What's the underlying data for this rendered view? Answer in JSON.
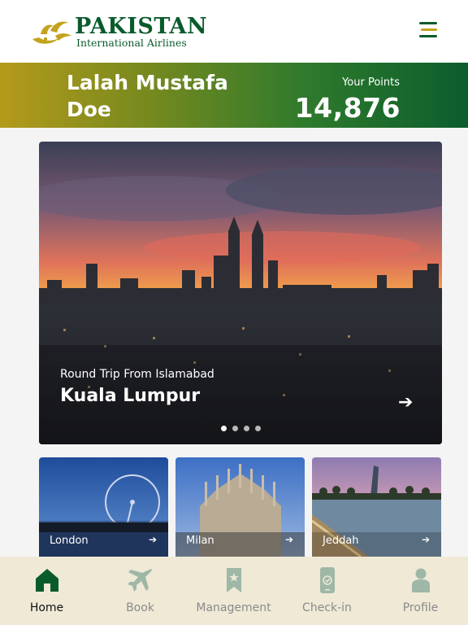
{
  "header": {
    "logo_title": "PAKISTAN",
    "logo_subtitle": "International Airlines",
    "menu_icon": "hamburger-icon"
  },
  "user": {
    "name": "Lalah Mustafa Doe",
    "points_label": "Your Points",
    "points_value": "14,876"
  },
  "hero": {
    "subtitle": "Round Trip From Islamabad",
    "title": "Kuala Lumpur",
    "arrow": "➔",
    "slides_total": 4,
    "active_slide": 1
  },
  "destinations": [
    {
      "label": "London",
      "arrow": "➔"
    },
    {
      "label": "Milan",
      "arrow": "➔"
    },
    {
      "label": "Jeddah",
      "arrow": "➔"
    }
  ],
  "nav": {
    "items": [
      {
        "label": "Home",
        "icon": "home-icon",
        "active": true
      },
      {
        "label": "Book",
        "icon": "airplane-icon",
        "active": false
      },
      {
        "label": "Management",
        "icon": "bookmark-icon",
        "active": false
      },
      {
        "label": "Check-in",
        "icon": "phone-check-icon",
        "active": false
      },
      {
        "label": "Profile",
        "icon": "person-icon",
        "active": false
      }
    ]
  },
  "colors": {
    "brand_green": "#0a5b2c",
    "brand_gold": "#c4a21d",
    "nav_background": "#efe9d6",
    "inactive_icon": "#9fb7a6"
  }
}
